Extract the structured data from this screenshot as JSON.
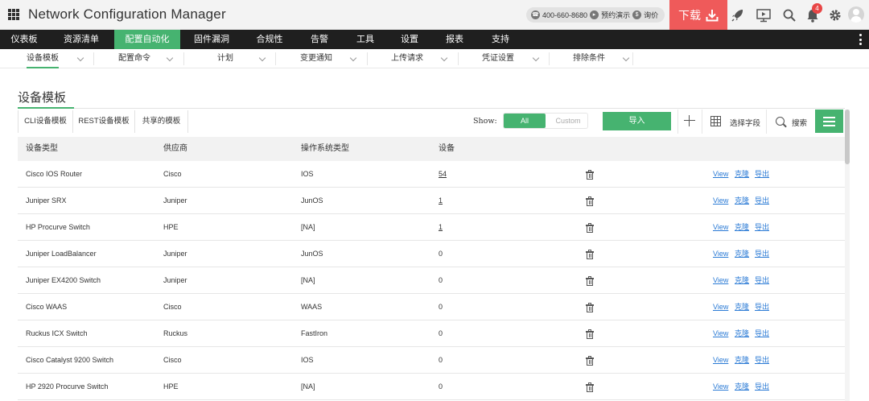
{
  "header": {
    "title": "Network Configuration Manager",
    "phone": "400-660-8680",
    "demo": "预约演示",
    "quote": "询价",
    "download": "下载",
    "notifications": "4"
  },
  "nav": [
    "仪表板",
    "资源清单",
    "配置自动化",
    "固件漏洞",
    "合规性",
    "告警",
    "工具",
    "设置",
    "报表",
    "支持"
  ],
  "nav_active": "配置自动化",
  "subnav": [
    "设备模板",
    "配置命令",
    "计划",
    "变更通知",
    "上传请求",
    "凭证设置",
    "排除条件"
  ],
  "page_title": "设备模板",
  "tabs": [
    "CLI设备模板",
    "REST设备模板",
    "共享的模板"
  ],
  "toolbar": {
    "show": "Show:",
    "all": "All",
    "custom": "Custom",
    "import": "导入",
    "select_fields": "选择字段",
    "search": "搜索"
  },
  "columns": [
    "设备类型",
    "供应商",
    "操作系统类型",
    "设备"
  ],
  "actions": [
    "View",
    "克隆",
    "导出"
  ],
  "rows": [
    {
      "type": "Cisco IOS Router",
      "vendor": "Cisco",
      "os": "IOS",
      "count": "54"
    },
    {
      "type": "Juniper SRX",
      "vendor": "Juniper",
      "os": "JunOS",
      "count": "1"
    },
    {
      "type": "HP Procurve Switch",
      "vendor": "HPE",
      "os": "[NA]",
      "count": "1"
    },
    {
      "type": "Juniper LoadBalancer",
      "vendor": "Juniper",
      "os": "JunOS",
      "count": "0"
    },
    {
      "type": "Juniper EX4200 Switch",
      "vendor": "Juniper",
      "os": "[NA]",
      "count": "0"
    },
    {
      "type": "Cisco WAAS",
      "vendor": "Cisco",
      "os": "WAAS",
      "count": "0"
    },
    {
      "type": "Ruckus ICX Switch",
      "vendor": "Ruckus",
      "os": "FastIron",
      "count": "0"
    },
    {
      "type": "Cisco Catalyst 9200 Switch",
      "vendor": "Cisco",
      "os": "IOS",
      "count": "0"
    },
    {
      "type": "HP 2920 Procurve Switch",
      "vendor": "HPE",
      "os": "[NA]",
      "count": "0"
    }
  ]
}
